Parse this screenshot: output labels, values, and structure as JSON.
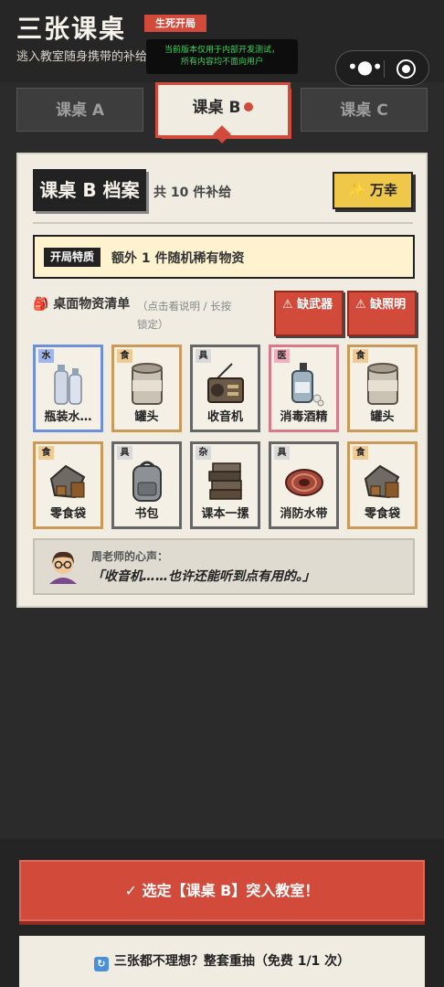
{
  "header": {
    "title": "三张课桌",
    "mode_badge": "生死开局",
    "subtitle": "逃入教室随身携带的补给",
    "notice_line1": "当前版本仅用于内部开发测试，",
    "notice_line2": "所有内容均不面向用户"
  },
  "tabs": [
    {
      "label": "课桌 A",
      "active": false
    },
    {
      "label": "课桌 B",
      "active": true
    },
    {
      "label": "课桌 C",
      "active": false
    }
  ],
  "card": {
    "title": "课桌 B 档案",
    "supply_count": "共 10 件补给",
    "luck_button": "✨ 万幸",
    "trait_tag": "开局特质",
    "trait_text": "额外 1 件随机稀有物资",
    "section_title": "🎒 桌面物资清单",
    "section_hint": "（点击看说明 / 长按锁定）",
    "warnings": [
      "⚠ 缺武器",
      "⚠ 缺照明"
    ]
  },
  "items": [
    {
      "category": "水",
      "name": "瓶装水…",
      "icon": "water-bottle-icon",
      "border": "#6f8fd6",
      "cat_bg": "#9fb6ec"
    },
    {
      "category": "食",
      "name": "罐头",
      "icon": "can-icon",
      "border": "#c99a5a",
      "cat_bg": "#eecb94"
    },
    {
      "category": "具",
      "name": "收音机",
      "icon": "radio-icon",
      "border": "#666666",
      "cat_bg": "#d9d9d9"
    },
    {
      "category": "医",
      "name": "消毒酒精",
      "icon": "sanitizer-icon",
      "border": "#d77a8a",
      "cat_bg": "#f2aebb"
    },
    {
      "category": "食",
      "name": "罐头",
      "icon": "can-icon",
      "border": "#c99a5a",
      "cat_bg": "#eecb94"
    },
    {
      "category": "食",
      "name": "零食袋",
      "icon": "snack-bag-icon",
      "border": "#c99a5a",
      "cat_bg": "#eecb94"
    },
    {
      "category": "具",
      "name": "书包",
      "icon": "backpack-icon",
      "border": "#666666",
      "cat_bg": "#d9d9d9"
    },
    {
      "category": "杂",
      "name": "课本一摞",
      "icon": "books-icon",
      "border": "#666666",
      "cat_bg": "#d9d9d9"
    },
    {
      "category": "具",
      "name": "消防水带",
      "icon": "fire-hose-icon",
      "border": "#666666",
      "cat_bg": "#d9d9d9"
    },
    {
      "category": "食",
      "name": "零食袋",
      "icon": "snack-bag-icon",
      "border": "#c99a5a",
      "cat_bg": "#eecb94"
    }
  ],
  "voice": {
    "who": "周老师的心声：",
    "quote": "「收音机……也许还能听到点有用的。」"
  },
  "actions": {
    "confirm": "✓ 选定【课桌 B】突入教室！",
    "reroll": "三张都不理想？整套重抽（免费 1/1 次）",
    "reroll_icon": "🔄"
  },
  "colors": {
    "accent": "#d24a3a",
    "paper": "#f0ece2",
    "gold": "#efc84a",
    "bg": "#2b2b2b"
  }
}
